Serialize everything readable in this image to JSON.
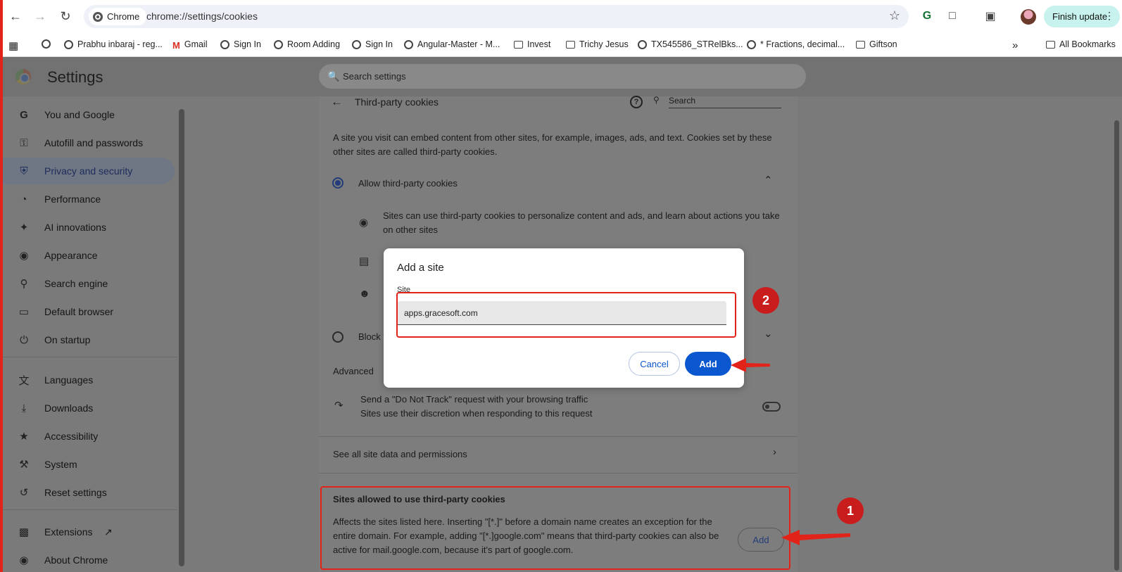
{
  "browser": {
    "chip_label": "Chrome",
    "url": "chrome://settings/cookies",
    "update_label": "Finish update"
  },
  "bookmarks": {
    "items": [
      {
        "label": "Prabhu inbaraj - reg...",
        "icon": "globe-icon"
      },
      {
        "label": "Gmail",
        "icon": "gmail-icon"
      },
      {
        "label": "Sign In",
        "icon": "globe-icon"
      },
      {
        "label": "Room Adding",
        "icon": "globe-icon"
      },
      {
        "label": "Sign In",
        "icon": "globe-icon"
      },
      {
        "label": "Angular-Master - M...",
        "icon": "globe-icon"
      },
      {
        "label": "Invest",
        "icon": "folder-icon"
      },
      {
        "label": "Trichy Jesus",
        "icon": "folder-icon"
      },
      {
        "label": "TX545586_STRelBks...",
        "icon": "globe-icon"
      },
      {
        "label": "* Fractions, decimal...",
        "icon": "globe-icon"
      },
      {
        "label": "Giftson",
        "icon": "folder-icon"
      }
    ],
    "all_bookmarks": "All Bookmarks"
  },
  "settings": {
    "title": "Settings",
    "search_placeholder": "Search settings"
  },
  "sidebar": {
    "items": [
      {
        "label": "You and Google",
        "icon": "google-icon"
      },
      {
        "label": "Autofill and passwords",
        "icon": "key-icon"
      },
      {
        "label": "Privacy and security",
        "icon": "shield-icon"
      },
      {
        "label": "Performance",
        "icon": "gauge-icon"
      },
      {
        "label": "AI innovations",
        "icon": "sparkle-icon"
      },
      {
        "label": "Appearance",
        "icon": "palette-icon"
      },
      {
        "label": "Search engine",
        "icon": "search-icon"
      },
      {
        "label": "Default browser",
        "icon": "browser-icon"
      },
      {
        "label": "On startup",
        "icon": "power-icon"
      },
      {
        "label": "Languages",
        "icon": "translate-icon"
      },
      {
        "label": "Downloads",
        "icon": "download-icon"
      },
      {
        "label": "Accessibility",
        "icon": "accessibility-icon"
      },
      {
        "label": "System",
        "icon": "wrench-icon"
      },
      {
        "label": "Reset settings",
        "icon": "reset-icon"
      },
      {
        "label": "Extensions",
        "icon": "puzzle-icon"
      },
      {
        "label": "About Chrome",
        "icon": "chrome-icon"
      }
    ]
  },
  "cookies_page": {
    "header_title": "Third-party cookies",
    "search_label": "Search",
    "intro": "A site you visit can embed content from other sites, for example, images, ads, and text. Cookies set by these other sites are called third-party cookies.",
    "allow_label": "Allow third-party cookies",
    "allow_detail": "Sites can use third-party cookies to personalize content and ads, and learn about actions you take on other sites",
    "block_label": "Block t",
    "advanced_label": "Advanced",
    "dnt_title": "Send a \"Do Not Track\" request with your browsing traffic",
    "dnt_detail": "Sites use their discretion when responding to this request",
    "see_all": "See all site data and permissions",
    "allowed_title": "Sites allowed to use third-party cookies",
    "allowed_desc": "Affects the sites listed here. Inserting \"[*.]\" before a domain name creates an exception for the entire domain. For example, adding \"[*.]google.com\" means that third-party cookies can also be active for mail.google.com, because it's part of google.com.",
    "add_label": "Add"
  },
  "dialog": {
    "title": "Add a site",
    "field_label": "Site",
    "field_value": "apps.gracesoft.com",
    "cancel_label": "Cancel",
    "add_label": "Add"
  },
  "annotations": {
    "step1": "1",
    "step2": "2",
    "color": "#e2231a"
  }
}
